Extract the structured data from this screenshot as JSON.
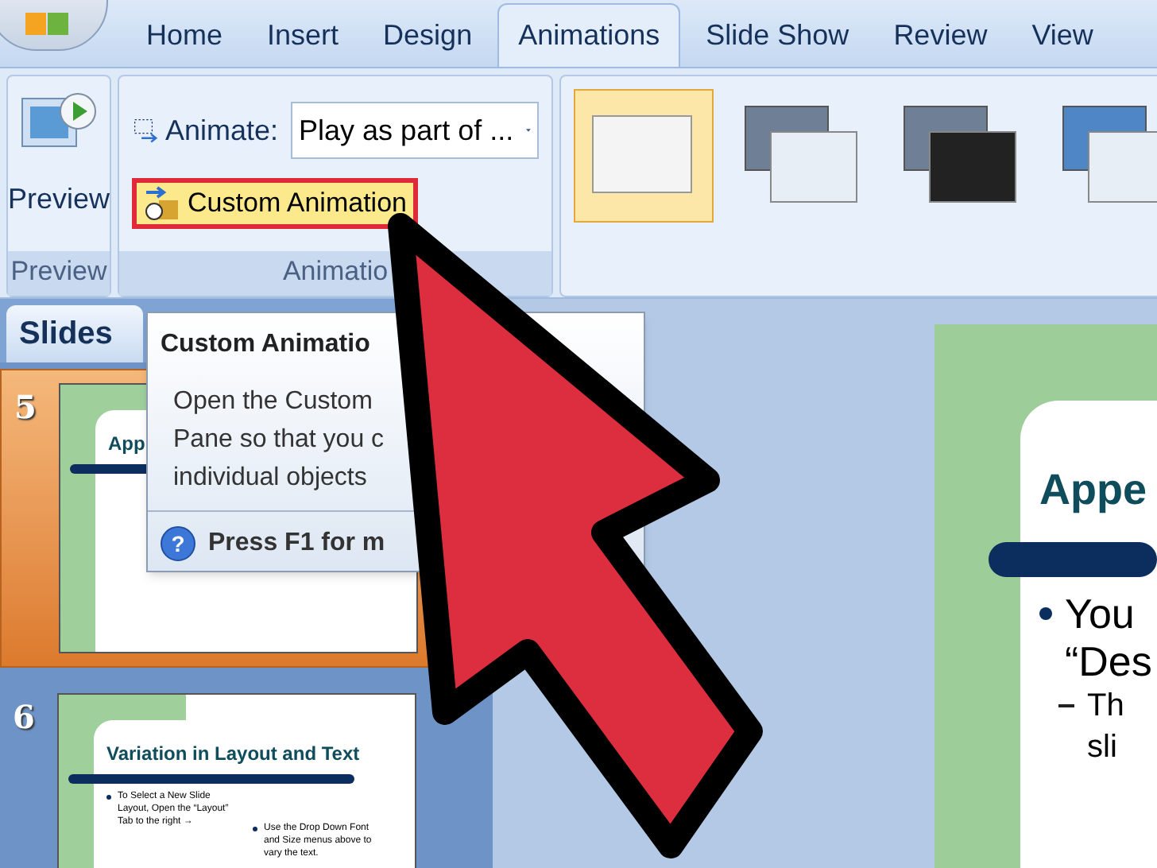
{
  "ribbon_tabs": [
    {
      "label": "Home",
      "selected": false
    },
    {
      "label": "Insert",
      "selected": false
    },
    {
      "label": "Design",
      "selected": false
    },
    {
      "label": "Animations",
      "selected": true
    },
    {
      "label": "Slide Show",
      "selected": false
    },
    {
      "label": "Review",
      "selected": false
    },
    {
      "label": "View",
      "selected": false
    }
  ],
  "preview_group": {
    "button": "Preview",
    "label": "Preview"
  },
  "animations_group": {
    "animate_label": "Animate:",
    "animate_value": "Play as part of ...",
    "custom_button": "Custom Animation",
    "label": "Animatio"
  },
  "transitions_gallery": [
    {
      "selected": true
    },
    {
      "selected": false
    },
    {
      "selected": false
    },
    {
      "selected": false
    }
  ],
  "slides_pane": {
    "tab": "Slides",
    "slides": [
      {
        "number": "5",
        "selected": true,
        "title": "App"
      },
      {
        "number": "6",
        "selected": false,
        "title": "Variation in Layout and Text",
        "bullets": [
          "To Select a New Slide Layout, Open the “Layout” Tab to the right →",
          "Use the Drop Down Font and Size menus above to vary the text."
        ]
      }
    ]
  },
  "tooltip": {
    "title": "Custom Animatio",
    "body": [
      "Open the Custom",
      "Pane so that you c",
      "individual objects"
    ],
    "help_icon": "?",
    "help": "Press F1 for m"
  },
  "slide": {
    "title": "Appe",
    "bullet_lines": [
      "You",
      "“Des"
    ],
    "sub_lines": [
      "Th",
      "sli"
    ]
  }
}
